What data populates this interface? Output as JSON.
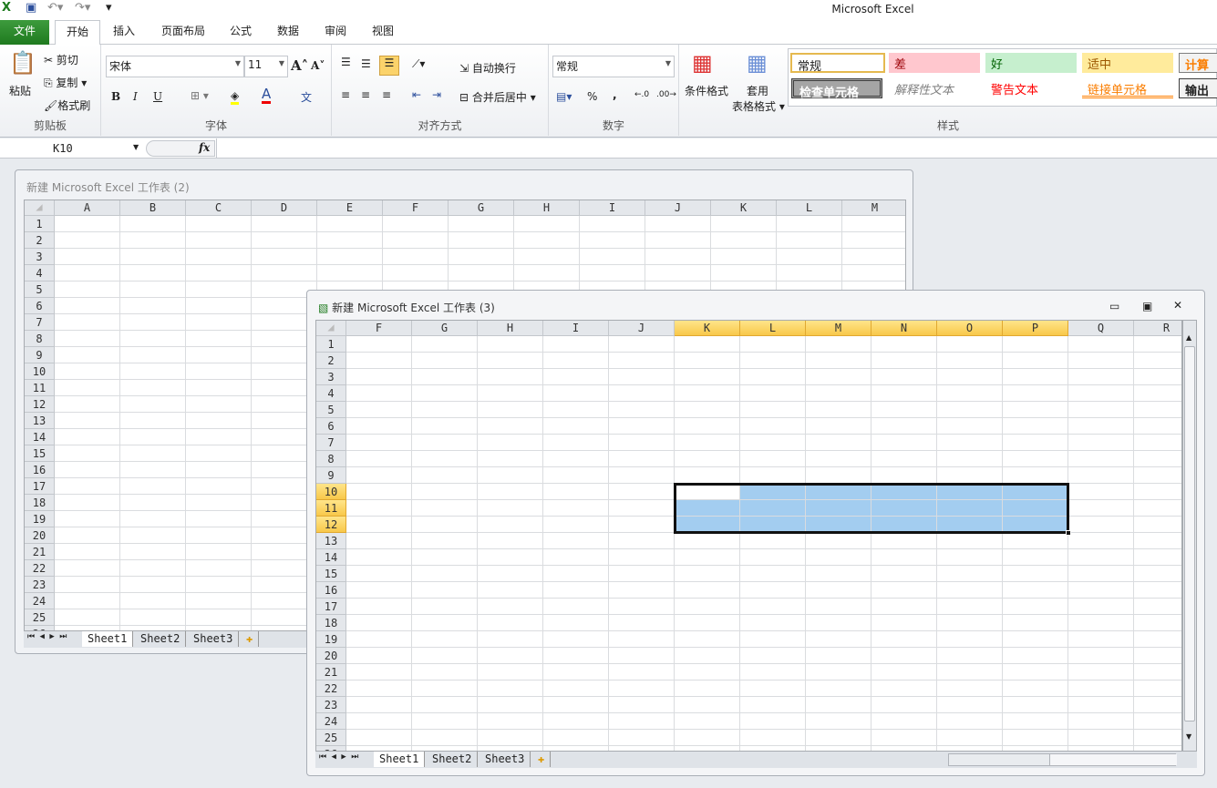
{
  "app": {
    "title": "Microsoft Excel"
  },
  "qat": [
    "excel-logo-icon",
    "save-icon",
    "undo-icon",
    "redo-icon",
    "customize-icon"
  ],
  "tabs": [
    "文件",
    "开始",
    "插入",
    "页面布局",
    "公式",
    "数据",
    "审阅",
    "视图"
  ],
  "ribbon": {
    "clipboard": {
      "paste": "粘贴",
      "cut": "剪切",
      "copy": "复制",
      "painter": "格式刷",
      "label": "剪贴板"
    },
    "font": {
      "name": "宋体",
      "size": "11",
      "label": "字体",
      "bold": "B",
      "italic": "I",
      "underline": "U",
      "grow": "A",
      "shrink": "A",
      "color_a": "A",
      "phonetic": "文"
    },
    "align": {
      "wrap": "自动换行",
      "merge": "合并后居中",
      "label": "对齐方式"
    },
    "number": {
      "format": "常规",
      "percent": "%",
      "comma": ",",
      "label": "数字"
    },
    "styles": {
      "cond": "条件格式",
      "table1": "套用",
      "table2": "表格格式",
      "label": "样式",
      "items": [
        "常规",
        "差",
        "好",
        "适中",
        "计算",
        "检查单元格",
        "解释性文本",
        "警告文本",
        "链接单元格",
        "输出"
      ]
    }
  },
  "formula_bar": {
    "name_box": "K10",
    "fx": "fx",
    "value": ""
  },
  "windows": {
    "back": {
      "title": "新建 Microsoft Excel 工作表 (2)",
      "columns": [
        "A",
        "B",
        "C",
        "D",
        "E",
        "F",
        "G",
        "H",
        "I",
        "J",
        "K",
        "L",
        "M"
      ],
      "sheets": [
        "Sheet1",
        "Sheet2",
        "Sheet3"
      ]
    },
    "front": {
      "title": "新建 Microsoft Excel 工作表 (3)",
      "columns": [
        "F",
        "G",
        "H",
        "I",
        "J",
        "K",
        "L",
        "M",
        "N",
        "O",
        "P",
        "Q",
        "R"
      ],
      "selected_columns": [
        "K",
        "L",
        "M",
        "N",
        "O",
        "P"
      ],
      "selected_rows": [
        10,
        11,
        12
      ],
      "active_cell": "K10",
      "selection": "K10:P12",
      "sheets": [
        "Sheet1",
        "Sheet2",
        "Sheet3"
      ]
    }
  },
  "colors": {
    "selection": "#a3cdf0",
    "header_selected": "#f8c84a",
    "file_tab": "#2a862a"
  }
}
